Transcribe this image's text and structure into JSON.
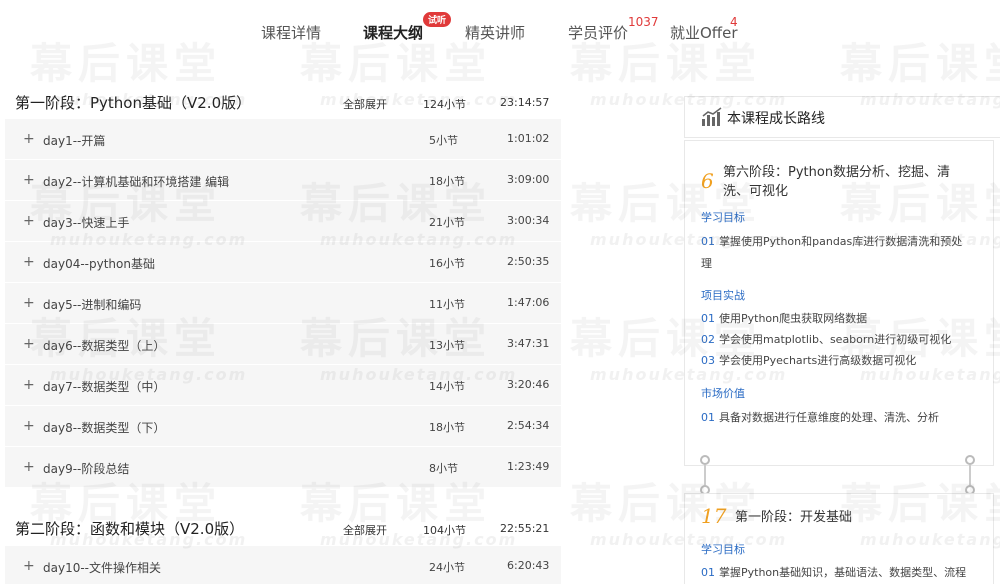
{
  "tabs": [
    {
      "label": "课程详情"
    },
    {
      "label": "课程大纲",
      "badge": "试听"
    },
    {
      "label": "精英讲师"
    },
    {
      "label": "学员评价",
      "count": "1037"
    },
    {
      "label": "就业Offer",
      "count": "4"
    }
  ],
  "stage1": {
    "title": "第一阶段：Python基础（V2.0版）",
    "expand": "全部展开",
    "count": "124小节",
    "time": "23:14:57"
  },
  "stage1_days": [
    {
      "name": "day1--开篇",
      "count": "5小节",
      "time": "1:01:02"
    },
    {
      "name": "day2--计算机基础和环境搭建 编辑",
      "count": "18小节",
      "time": "3:09:00"
    },
    {
      "name": "day3--快速上手",
      "count": "21小节",
      "time": "3:00:34"
    },
    {
      "name": "day04--python基础",
      "count": "16小节",
      "time": "2:50:35"
    },
    {
      "name": "day5--进制和编码",
      "count": "11小节",
      "time": "1:47:06"
    },
    {
      "name": "day6--数据类型（上）",
      "count": "13小节",
      "time": "3:47:31"
    },
    {
      "name": "day7--数据类型（中）",
      "count": "14小节",
      "time": "3:20:46"
    },
    {
      "name": "day8--数据类型（下）",
      "count": "18小节",
      "time": "2:54:34"
    },
    {
      "name": "day9--阶段总结",
      "count": "8小节",
      "time": "1:23:49"
    }
  ],
  "stage2": {
    "title": "第二阶段：函数和模块（V2.0版）",
    "expand": "全部展开",
    "count": "104小节",
    "time": "22:55:21"
  },
  "stage2_days": [
    {
      "name": "day10--文件操作相关",
      "count": "24小节",
      "time": "6:20:43"
    }
  ],
  "route": {
    "title": "本课程成长路线",
    "icon": "chart-bars-icon"
  },
  "card6": {
    "num": "6",
    "title": "第六阶段：Python数据分析、挖掘、清洗、可视化",
    "goal_label": "学习目标",
    "goals": [
      {
        "idx": "01",
        "text": "掌握使用Python和pandas库进行数据清洗和预处理"
      }
    ],
    "project_label": "项目实战",
    "projects": [
      {
        "idx": "01",
        "text": "使用Python爬虫获取网络数据"
      },
      {
        "idx": "02",
        "text": "学会使用matplotlib、seaborn进行初级可视化"
      },
      {
        "idx": "03",
        "text": "学会使用Pyecharts进行高级数据可视化"
      }
    ],
    "market_label": "市场价值",
    "market": [
      {
        "idx": "01",
        "text": "具备对数据进行任意维度的处理、清洗、分析"
      }
    ]
  },
  "card17": {
    "num": "17",
    "title": "第一阶段：开发基础",
    "goal_label": "学习目标",
    "goals": [
      {
        "idx": "01",
        "text": "掌握Python基础知识，基础语法、数据类型、流程"
      }
    ]
  },
  "watermark": {
    "text": "幕后课堂",
    "url": "muhouketang.com"
  },
  "colors": {
    "accent": "#2a6bc4",
    "badge": "#e03a3a",
    "number": "#f0a020",
    "row_bg": "#f6f6f6"
  }
}
